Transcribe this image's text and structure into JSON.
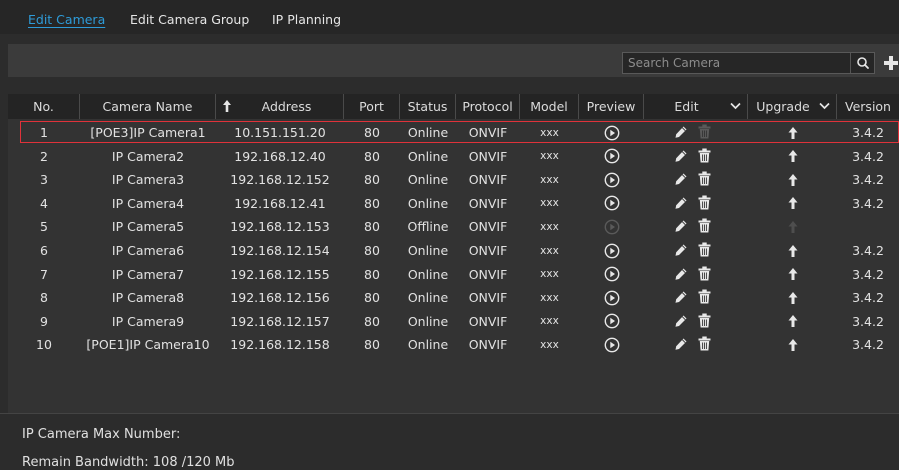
{
  "tabs": [
    {
      "label": "Edit Camera",
      "active": true
    },
    {
      "label": "Edit Camera Group",
      "active": false
    },
    {
      "label": "IP Planning",
      "active": false
    }
  ],
  "search": {
    "placeholder": "Search Camera",
    "icon": "magnifier-icon"
  },
  "add": {
    "icon": "plus-icon"
  },
  "columns": {
    "no": "No.",
    "name": "Camera Name",
    "address": "Address",
    "port": "Port",
    "status": "Status",
    "protocol": "Protocol",
    "model": "Model",
    "preview": "Preview",
    "edit": "Edit",
    "upgrade": "Upgrade",
    "version": "Version"
  },
  "rows": [
    {
      "no": "1",
      "name": "[POE3]IP Camera1",
      "address": "10.151.151.20",
      "port": "80",
      "status": "Online",
      "protocol": "ONVIF",
      "model": "xxx",
      "version": "3.4.2",
      "enabled": true,
      "selected": true
    },
    {
      "no": "2",
      "name": "IP Camera2",
      "address": "192.168.12.40",
      "port": "80",
      "status": "Online",
      "protocol": "ONVIF",
      "model": "xxx",
      "version": "3.4.2",
      "enabled": true,
      "selected": false
    },
    {
      "no": "3",
      "name": "IP Camera3",
      "address": "192.168.12.152",
      "port": "80",
      "status": "Online",
      "protocol": "ONVIF",
      "model": "xxx",
      "version": "3.4.2",
      "enabled": true,
      "selected": false
    },
    {
      "no": "4",
      "name": "IP Camera4",
      "address": "192.168.12.41",
      "port": "80",
      "status": "Online",
      "protocol": "ONVIF",
      "model": "xxx",
      "version": "3.4.2",
      "enabled": true,
      "selected": false
    },
    {
      "no": "5",
      "name": "IP Camera5",
      "address": "192.168.12.153",
      "port": "80",
      "status": "Offline",
      "protocol": "ONVIF",
      "model": "xxx",
      "version": "",
      "enabled": false,
      "selected": false
    },
    {
      "no": "6",
      "name": "IP Camera6",
      "address": "192.168.12.154",
      "port": "80",
      "status": "Online",
      "protocol": "ONVIF",
      "model": "xxx",
      "version": "3.4.2",
      "enabled": true,
      "selected": false
    },
    {
      "no": "7",
      "name": "IP Camera7",
      "address": "192.168.12.155",
      "port": "80",
      "status": "Online",
      "protocol": "ONVIF",
      "model": "xxx",
      "version": "3.4.2",
      "enabled": true,
      "selected": false
    },
    {
      "no": "8",
      "name": "IP Camera8",
      "address": "192.168.12.156",
      "port": "80",
      "status": "Online",
      "protocol": "ONVIF",
      "model": "xxx",
      "version": "3.4.2",
      "enabled": true,
      "selected": false
    },
    {
      "no": "9",
      "name": "IP Camera9",
      "address": "192.168.12.157",
      "port": "80",
      "status": "Online",
      "protocol": "ONVIF",
      "model": "xxx",
      "version": "3.4.2",
      "enabled": true,
      "selected": false
    },
    {
      "no": "10",
      "name": "[POE1]IP Camera10",
      "address": "192.168.12.158",
      "port": "80",
      "status": "Online",
      "protocol": "ONVIF",
      "model": "xxx",
      "version": "3.4.2",
      "enabled": true,
      "selected": false
    }
  ],
  "icons": {
    "preview": "play-icon",
    "edit": "pencil-icon",
    "delete": "trash-icon",
    "upgrade": "upload-arrow-icon",
    "sort": "sort-up-arrow-icon",
    "dropdown": "chevron-down-icon"
  },
  "info": {
    "max_number": "IP Camera Max Number:",
    "bandwidth": "Remain Bandwidth: 108 /120 Mb"
  },
  "colors": {
    "accent": "#2e9bd8",
    "selected_border": "#e0323a",
    "background": "#2c2c2c",
    "header": "#242424"
  }
}
